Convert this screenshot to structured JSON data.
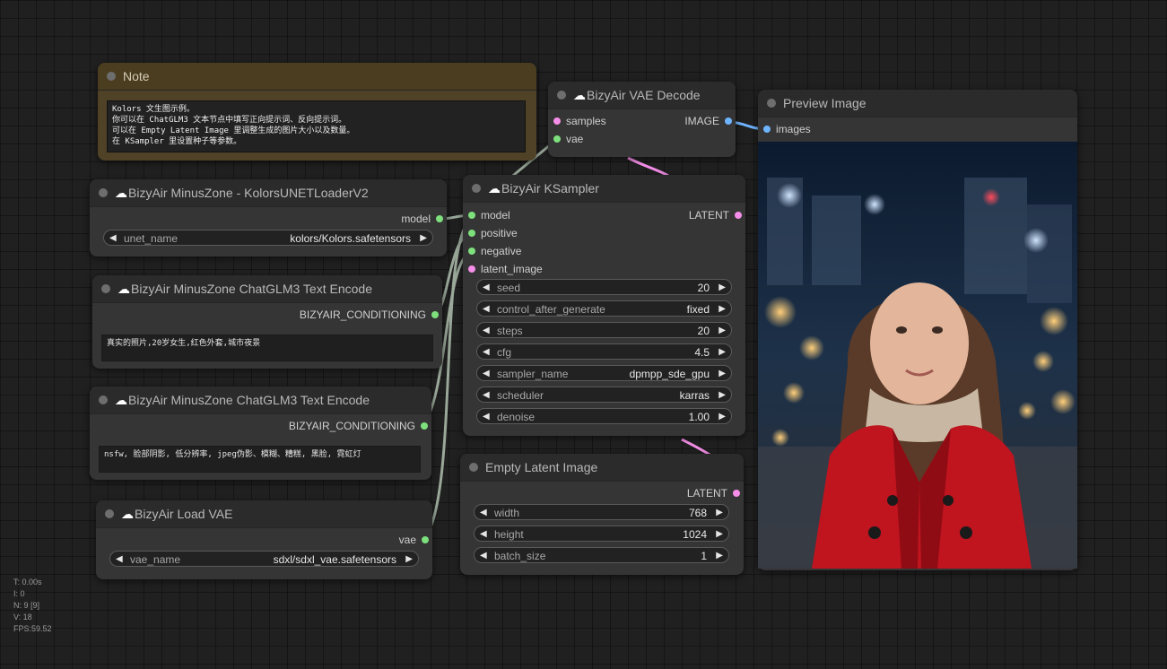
{
  "note": {
    "title": "Note",
    "text": "Kolors 文生图示例。\n你可以在 ChatGLM3 文本节点中填写正向提示词、反向提示词。\n可以在 Empty Latent Image 里调整生成的图片大小以及数量。\n在 KSampler 里设置种子等参数。"
  },
  "unet_loader": {
    "icon": "cloud-icon",
    "title": "BizyAir MinusZone - KolorsUNETLoaderV2",
    "output": "model",
    "widget_name": "unet_name",
    "widget_value": "kolors/Kolors.safetensors"
  },
  "text_encode_pos": {
    "title": "BizyAir MinusZone ChatGLM3 Text Encode",
    "output": "BIZYAIR_CONDITIONING",
    "text": "真实的照片,20岁女生,红色外套,城市夜景"
  },
  "text_encode_neg": {
    "title": "BizyAir MinusZone ChatGLM3 Text Encode",
    "output": "BIZYAIR_CONDITIONING",
    "text": "nsfw, 脸部阴影, 低分辨率, jpeg伪影、模糊、糟糕, 黑脸, 霓虹灯"
  },
  "load_vae": {
    "title": "BizyAir Load VAE",
    "output": "vae",
    "widget_name": "vae_name",
    "widget_value": "sdxl/sdxl_vae.safetensors"
  },
  "vae_decode": {
    "title": "BizyAir VAE Decode",
    "inputs": [
      "samples",
      "vae"
    ],
    "output": "IMAGE"
  },
  "ksampler": {
    "title": "BizyAir KSampler",
    "inputs": [
      "model",
      "positive",
      "negative",
      "latent_image"
    ],
    "output": "LATENT",
    "widgets": [
      {
        "name": "seed",
        "value": "20"
      },
      {
        "name": "control_after_generate",
        "value": "fixed"
      },
      {
        "name": "steps",
        "value": "20"
      },
      {
        "name": "cfg",
        "value": "4.5"
      },
      {
        "name": "sampler_name",
        "value": "dpmpp_sde_gpu"
      },
      {
        "name": "scheduler",
        "value": "karras"
      },
      {
        "name": "denoise",
        "value": "1.00"
      }
    ]
  },
  "empty_latent": {
    "title": "Empty Latent Image",
    "output": "LATENT",
    "widgets": [
      {
        "name": "width",
        "value": "768"
      },
      {
        "name": "height",
        "value": "1024"
      },
      {
        "name": "batch_size",
        "value": "1"
      }
    ]
  },
  "preview": {
    "title": "Preview Image",
    "input": "images"
  },
  "stats": [
    "T: 0.00s",
    "I: 0",
    "N: 9 [9]",
    "V: 18",
    "FPS:59.52"
  ],
  "colors": {
    "canvas": "#202020",
    "node": "#353535",
    "link_grey": "#9aa89a",
    "link_pink": "#f58ee8",
    "link_blue": "#6fb4ff"
  }
}
